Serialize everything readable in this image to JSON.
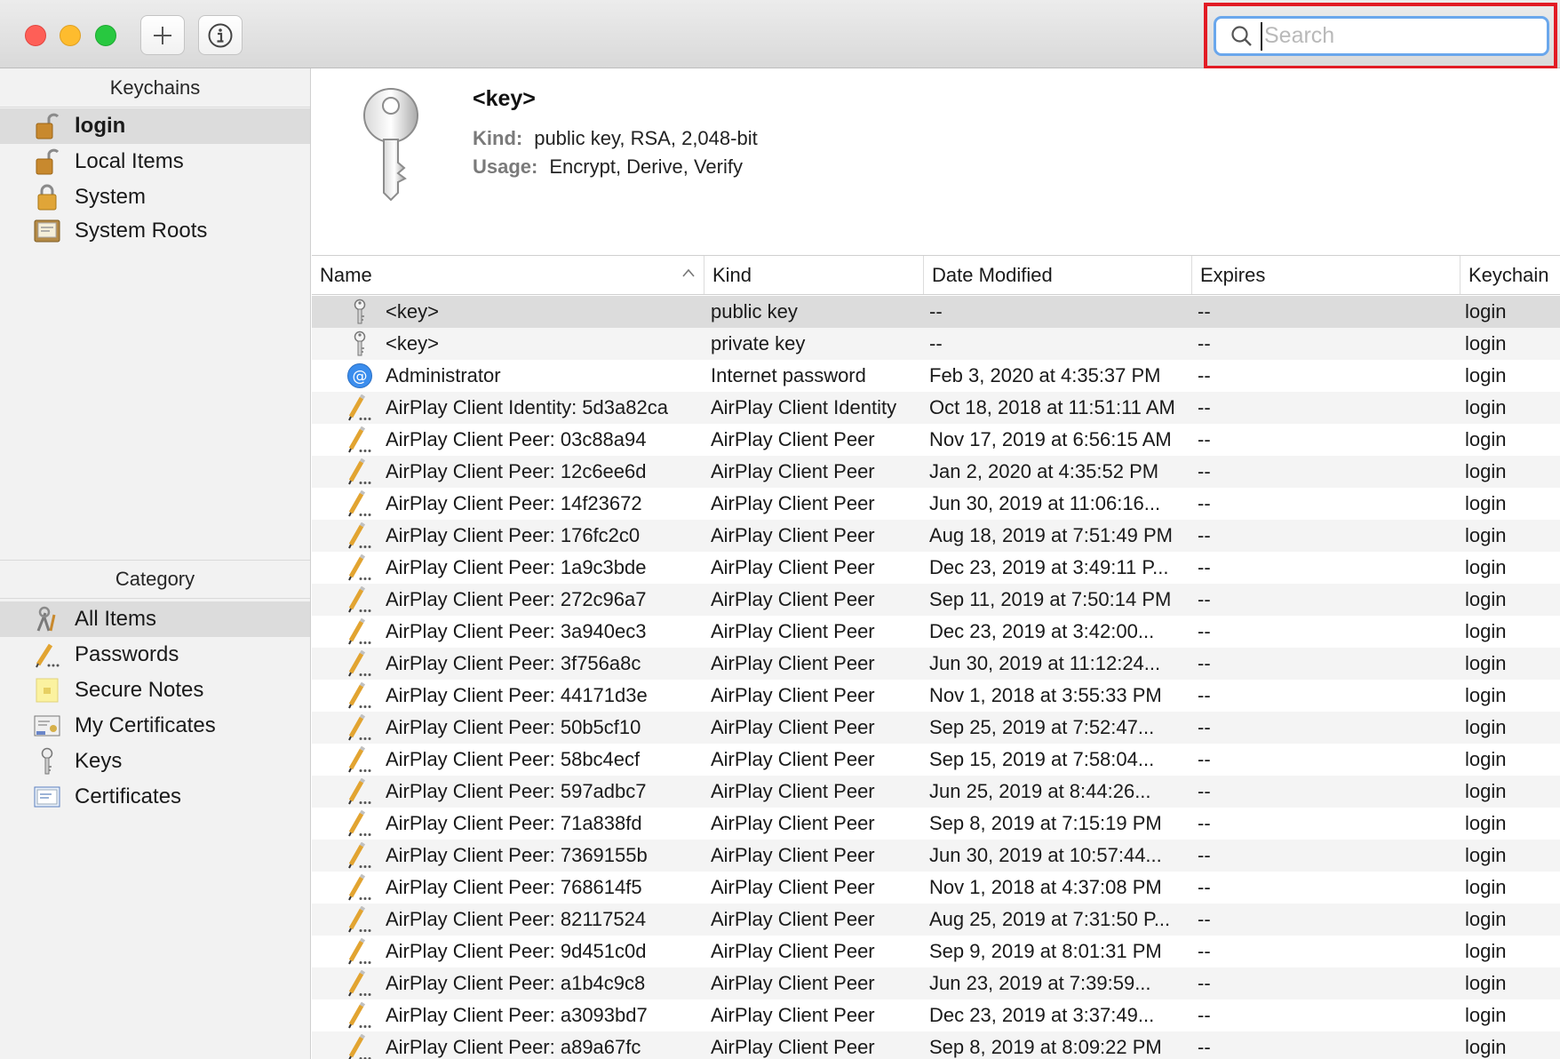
{
  "toolbar": {
    "add_button": "plus-icon",
    "info_button": "info-icon",
    "search_placeholder": "Search",
    "search_value": ""
  },
  "sidebar": {
    "keychains_header": "Keychains",
    "keychains": [
      {
        "label": "login",
        "icon": "unlocked-padlock-icon",
        "selected": true
      },
      {
        "label": "Local Items",
        "icon": "unlocked-padlock-icon",
        "selected": false
      },
      {
        "label": "System",
        "icon": "locked-padlock-icon",
        "selected": false
      },
      {
        "label": "System Roots",
        "icon": "certificate-cabinet-icon",
        "selected": false
      }
    ],
    "category_header": "Category",
    "categories": [
      {
        "label": "All Items",
        "icon": "all-items-icon",
        "selected": true
      },
      {
        "label": "Passwords",
        "icon": "pencil-icon",
        "selected": false
      },
      {
        "label": "Secure Notes",
        "icon": "note-icon",
        "selected": false
      },
      {
        "label": "My Certificates",
        "icon": "my-certificate-icon",
        "selected": false
      },
      {
        "label": "Keys",
        "icon": "key-icon",
        "selected": false
      },
      {
        "label": "Certificates",
        "icon": "certificate-icon",
        "selected": false
      }
    ]
  },
  "detail": {
    "name": "<key>",
    "kind_label": "Kind:",
    "kind_value": "public key, RSA, 2,048-bit",
    "usage_label": "Usage:",
    "usage_value": "Encrypt, Derive, Verify"
  },
  "table": {
    "columns": [
      "Name",
      "Kind",
      "Date Modified",
      "Expires",
      "Keychain"
    ],
    "rows": [
      {
        "icon": "key-icon",
        "name": "<key>",
        "kind": "public key",
        "date": "--",
        "expires": "--",
        "keychain": "login"
      },
      {
        "icon": "key-icon",
        "name": "<key>",
        "kind": "private key",
        "date": "--",
        "expires": "--",
        "keychain": "login"
      },
      {
        "icon": "at-sign-icon",
        "name": "Administrator",
        "kind": "Internet password",
        "date": "Feb 3, 2020 at 4:35:37 PM",
        "expires": "--",
        "keychain": "login"
      },
      {
        "icon": "pencil-icon",
        "name": "AirPlay Client Identity: 5d3a82ca",
        "kind": "AirPlay Client Identity",
        "date": "Oct 18, 2018 at 11:51:11 AM",
        "expires": "--",
        "keychain": "login"
      },
      {
        "icon": "pencil-icon",
        "name": "AirPlay Client Peer: 03c88a94",
        "kind": "AirPlay Client Peer",
        "date": "Nov 17, 2019 at 6:56:15 AM",
        "expires": "--",
        "keychain": "login"
      },
      {
        "icon": "pencil-icon",
        "name": "AirPlay Client Peer: 12c6ee6d",
        "kind": "AirPlay Client Peer",
        "date": "Jan 2, 2020 at 4:35:52 PM",
        "expires": "--",
        "keychain": "login"
      },
      {
        "icon": "pencil-icon",
        "name": "AirPlay Client Peer: 14f23672",
        "kind": "AirPlay Client Peer",
        "date": "Jun 30, 2019 at 11:06:16...",
        "expires": "--",
        "keychain": "login"
      },
      {
        "icon": "pencil-icon",
        "name": "AirPlay Client Peer: 176fc2c0",
        "kind": "AirPlay Client Peer",
        "date": "Aug 18, 2019 at 7:51:49 PM",
        "expires": "--",
        "keychain": "login"
      },
      {
        "icon": "pencil-icon",
        "name": "AirPlay Client Peer: 1a9c3bde",
        "kind": "AirPlay Client Peer",
        "date": "Dec 23, 2019 at 3:49:11 P...",
        "expires": "--",
        "keychain": "login"
      },
      {
        "icon": "pencil-icon",
        "name": "AirPlay Client Peer: 272c96a7",
        "kind": "AirPlay Client Peer",
        "date": "Sep 11, 2019 at 7:50:14 PM",
        "expires": "--",
        "keychain": "login"
      },
      {
        "icon": "pencil-icon",
        "name": "AirPlay Client Peer: 3a940ec3",
        "kind": "AirPlay Client Peer",
        "date": "Dec 23, 2019 at 3:42:00...",
        "expires": "--",
        "keychain": "login"
      },
      {
        "icon": "pencil-icon",
        "name": "AirPlay Client Peer: 3f756a8c",
        "kind": "AirPlay Client Peer",
        "date": "Jun 30, 2019 at 11:12:24...",
        "expires": "--",
        "keychain": "login"
      },
      {
        "icon": "pencil-icon",
        "name": "AirPlay Client Peer: 44171d3e",
        "kind": "AirPlay Client Peer",
        "date": "Nov 1, 2018 at 3:55:33 PM",
        "expires": "--",
        "keychain": "login"
      },
      {
        "icon": "pencil-icon",
        "name": "AirPlay Client Peer: 50b5cf10",
        "kind": "AirPlay Client Peer",
        "date": "Sep 25, 2019 at 7:52:47...",
        "expires": "--",
        "keychain": "login"
      },
      {
        "icon": "pencil-icon",
        "name": "AirPlay Client Peer: 58bc4ecf",
        "kind": "AirPlay Client Peer",
        "date": "Sep 15, 2019 at 7:58:04...",
        "expires": "--",
        "keychain": "login"
      },
      {
        "icon": "pencil-icon",
        "name": "AirPlay Client Peer: 597adbc7",
        "kind": "AirPlay Client Peer",
        "date": "Jun 25, 2019 at 8:44:26...",
        "expires": "--",
        "keychain": "login"
      },
      {
        "icon": "pencil-icon",
        "name": "AirPlay Client Peer: 71a838fd",
        "kind": "AirPlay Client Peer",
        "date": "Sep 8, 2019 at 7:15:19 PM",
        "expires": "--",
        "keychain": "login"
      },
      {
        "icon": "pencil-icon",
        "name": "AirPlay Client Peer: 7369155b",
        "kind": "AirPlay Client Peer",
        "date": "Jun 30, 2019 at 10:57:44...",
        "expires": "--",
        "keychain": "login"
      },
      {
        "icon": "pencil-icon",
        "name": "AirPlay Client Peer: 768614f5",
        "kind": "AirPlay Client Peer",
        "date": "Nov 1, 2018 at 4:37:08 PM",
        "expires": "--",
        "keychain": "login"
      },
      {
        "icon": "pencil-icon",
        "name": "AirPlay Client Peer: 82117524",
        "kind": "AirPlay Client Peer",
        "date": "Aug 25, 2019 at 7:31:50 P...",
        "expires": "--",
        "keychain": "login"
      },
      {
        "icon": "pencil-icon",
        "name": "AirPlay Client Peer: 9d451c0d",
        "kind": "AirPlay Client Peer",
        "date": "Sep 9, 2019 at 8:01:31 PM",
        "expires": "--",
        "keychain": "login"
      },
      {
        "icon": "pencil-icon",
        "name": "AirPlay Client Peer: a1b4c9c8",
        "kind": "AirPlay Client Peer",
        "date": "Jun 23, 2019 at 7:39:59...",
        "expires": "--",
        "keychain": "login"
      },
      {
        "icon": "pencil-icon",
        "name": "AirPlay Client Peer: a3093bd7",
        "kind": "AirPlay Client Peer",
        "date": "Dec 23, 2019 at 3:37:49...",
        "expires": "--",
        "keychain": "login"
      },
      {
        "icon": "pencil-icon",
        "name": "AirPlay Client Peer: a89a67fc",
        "kind": "AirPlay Client Peer",
        "date": "Sep 8, 2019 at 8:09:22 PM",
        "expires": "--",
        "keychain": "login"
      }
    ]
  }
}
